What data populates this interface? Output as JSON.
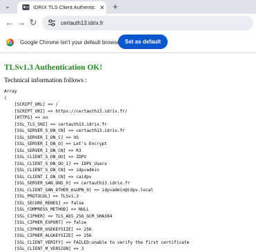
{
  "browser": {
    "tab": {
      "title": "IDRIX TLS Client Authentication",
      "close_glyph": "✕"
    },
    "new_tab_glyph": "+",
    "tab_list_glyph": "⌄",
    "back_glyph": "←",
    "forward_glyph": "→",
    "reload_glyph": "↻",
    "url": "certauth13.idrix.fr",
    "infobar": {
      "message": "Google Chrome isn't your default browser",
      "button_label": "Set as default"
    }
  },
  "page": {
    "heading": "TLSv1.3 Authentication OK!",
    "subheading": "Technical information follows :",
    "dump_lines": [
      "Array",
      "(",
      "    [SCRIPT_URL] => /",
      "    [SCRIPT_URI] => https://certauth13.idrix.fr/",
      "    [HTTPS] => on",
      "    [SSL_TLS_SNI] => certauth13.idrix.fr",
      "    [SSL_SERVER_S_DN_CN] => certauth13.idrix.fr",
      "    [SSL_SERVER_I_DN_C] => US",
      "    [SSL_SERVER_I_DN_O] => Let's Encrypt",
      "    [SSL_SERVER_I_DN_CN] => R3",
      "    [SSL_CLIENT_S_DN_OU] => IDPV",
      "    [SSL_CLIENT_S_DN_OU_1] => IDPV_Users",
      "    [SSL_CLIENT_S_DN_CN] => idpvadmin",
      "    [SSL_CLIENT_I_DN_CN] => caidpv",
      "    [SSL_SERVER_SAN_DNS_0] => certauth13.idrix.fr",
      "    [SSL_CLIENT_SAN_OTHER_msUPN_0] => idpvadmin@idpv.local",
      "    [SSL_PROTOCOL] => TLSv1.3",
      "    [SSL_SECURE_RENEG] => false",
      "    [SSL_COMPRESS_METHOD] => NULL",
      "    [SSL_CIPHER] => TLS_AES_256_GCM_SHA384",
      "    [SSL_CIPHER_EXPORT] => false",
      "    [SSL_CIPHER_USEKEYSIZE] => 256",
      "    [SSL_CIPHER_ALGKEYSIZE] => 256",
      "    [SSL_CLIENT_VERIFY] => FAILED:unable to verify the first certificate",
      "    [SSL_CLIENT_M_VERSION] => 3"
    ]
  },
  "colors": {
    "heading": "#228b22",
    "accent_button": "#0b57d0",
    "tabstrip": "#dfe3e8",
    "omnibox": "#e9edf2"
  },
  "icons": {
    "favicon": "id-card-favicon",
    "site_info": "tune-icon",
    "infobar_logo": "chrome-logo"
  }
}
